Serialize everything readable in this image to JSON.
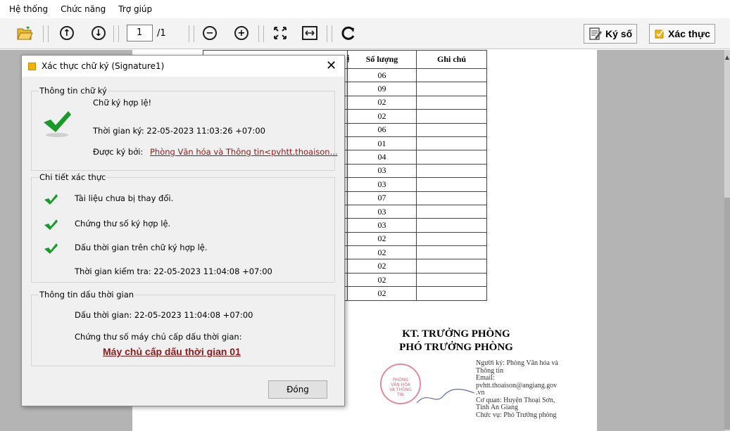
{
  "menu": {
    "items": [
      "Hệ thống",
      "Chức năng",
      "Trợ giúp"
    ]
  },
  "toolbar": {
    "page_current": "1",
    "page_total": "/1",
    "sign_label": "Ký số",
    "verify_label": "Xác thực",
    "icons": [
      "open-folder-icon",
      "arrow-up-icon",
      "arrow-down-icon",
      "zoom-out-icon",
      "zoom-in-icon",
      "fit-page-icon",
      "fit-width-icon",
      "rotate-icon",
      "sign-icon",
      "verify-icon"
    ]
  },
  "document": {
    "partial_header": "ị",
    "headers": {
      "quantity": "Số lượng",
      "note": "Ghi chú"
    },
    "quantities": [
      "06",
      "09",
      "02",
      "02",
      "06",
      "01",
      "04",
      "03",
      "03",
      "07",
      "03",
      "03",
      "02",
      "02",
      "02",
      "02",
      "02"
    ],
    "signature_title_1": "KT. TRƯỞNG PHÒNG",
    "signature_title_2": "PHÓ TRƯỞNG PHÒNG",
    "signer_info": [
      "Người ký: Phòng Văn hóa và",
      "Thông tin",
      "Email:",
      "pvhtt.thoaison@angiang.gov",
      ".vn",
      "Cơ quan: Huyện Thoại Sơn,",
      "Tỉnh An Giang",
      "Chức vụ: Phó Trưởng phòng"
    ],
    "stamp_text": [
      "PHÒNG",
      "VĂN HÓA",
      "VÀ THÔNG TIN"
    ]
  },
  "dialog": {
    "title": "Xác thực chữ ký (Signature1)",
    "close_symbol": "✕",
    "sig_info": {
      "label": "Thông tin chữ ký",
      "valid": "Chữ ký hợp lệ!",
      "sign_time": "Thời gian ký: 22-05-2023 11:03:26 +07:00",
      "signed_by_label": "Được ký bởi:",
      "signed_by_value": "Phòng Văn hóa và Thông tin<pvhtt.thoaison..."
    },
    "verify_details": {
      "label": "Chi tiết xác thực",
      "items": [
        "Tài liệu chưa bị thay đổi.",
        "Chứng thư số ký hợp lệ.",
        "Dấu thời gian trên chữ ký hợp lệ."
      ],
      "check_time": "Thời gian kiểm tra: 22-05-2023 11:04:08 +07:00"
    },
    "timestamp_info": {
      "label": "Thông tin dấu thời gian",
      "stamp_time": "Dấu thời gian: 22-05-2023 11:04:08 +07:00",
      "server_cert_label": "Chứng thư số máy chủ cấp dấu thời gian:",
      "server_name": "Máy chủ cấp dấu thời gian 01"
    },
    "close_button": "Đóng"
  },
  "colors": {
    "check_green": "#1a9a2a",
    "link_red": "#8b1a1a",
    "viewer_gray": "#b4b4b4"
  }
}
